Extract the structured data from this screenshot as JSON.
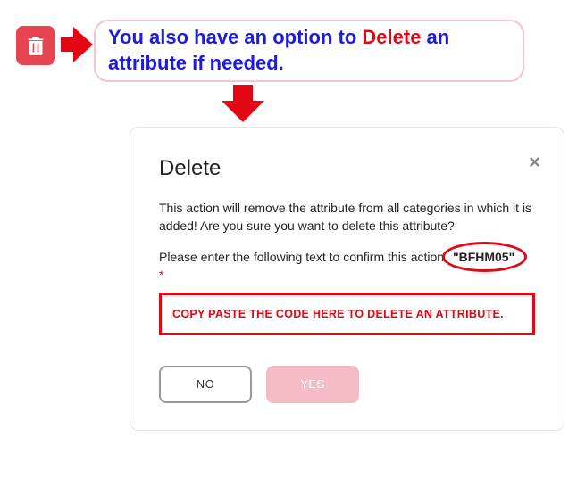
{
  "callout": {
    "text_pre": "You also have an option to ",
    "text_red": "Delete",
    "text_post": " an attribute if needed."
  },
  "modal": {
    "title": "Delete",
    "close_label": "×",
    "body": "This action will remove the attribute from all categories in which it is added! Are you sure you want to delete this attribute?",
    "confirm_prompt": "Please enter the following text to confirm this action ",
    "confirm_code": "\"BFHM05\"",
    "required_mark": "*",
    "input_placeholder": "COPY PASTE THE CODE HERE TO DELETE AN ATTRIBUTE.",
    "no_label": "NO",
    "yes_label": "YES"
  }
}
